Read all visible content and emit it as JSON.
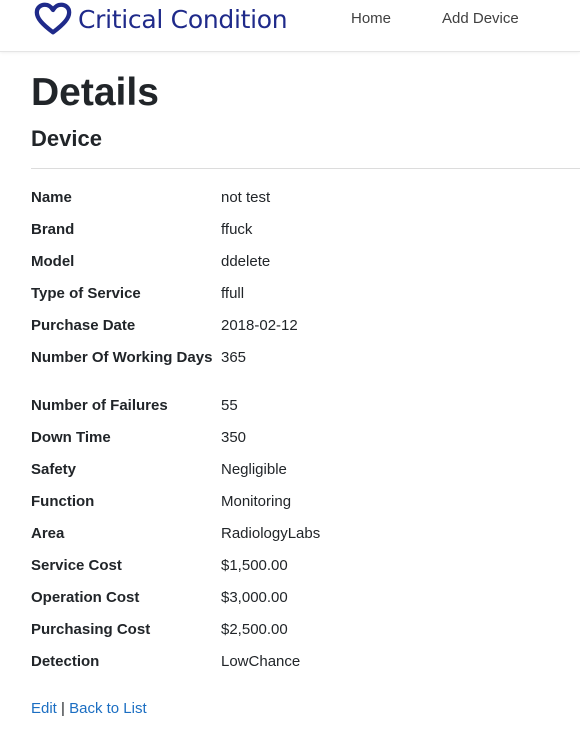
{
  "header": {
    "brand_text": "Critical Condition",
    "nav": {
      "home": "Home",
      "add_device": "Add Device"
    }
  },
  "page": {
    "title": "Details",
    "subtitle": "Device"
  },
  "details": [
    {
      "label": "Name",
      "value": "not test"
    },
    {
      "label": "Brand",
      "value": "ffuck"
    },
    {
      "label": "Model",
      "value": "ddelete"
    },
    {
      "label": "Type of Service",
      "value": "ffull"
    },
    {
      "label": "Purchase Date",
      "value": "2018-02-12"
    },
    {
      "label": "Number Of Working Days",
      "value": "365"
    },
    {
      "label": "Number of Failures",
      "value": "55"
    },
    {
      "label": "Down Time",
      "value": "350"
    },
    {
      "label": "Safety",
      "value": "Negligible"
    },
    {
      "label": "Function",
      "value": "Monitoring"
    },
    {
      "label": "Area",
      "value": "RadiologyLabs"
    },
    {
      "label": "Service Cost",
      "value": "$1,500.00"
    },
    {
      "label": "Operation Cost",
      "value": "$3,000.00"
    },
    {
      "label": "Purchasing Cost",
      "value": "$2,500.00"
    },
    {
      "label": "Detection",
      "value": "LowChance"
    }
  ],
  "actions": {
    "edit": "Edit",
    "separator": "|",
    "back": "Back to List"
  },
  "colors": {
    "brand": "#1f2a8a",
    "link": "#1b6ec2",
    "text": "#212529"
  }
}
